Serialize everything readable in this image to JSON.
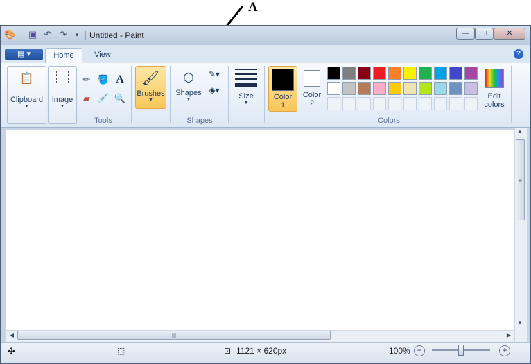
{
  "annotation": {
    "label": "A"
  },
  "window": {
    "title": "Untitled - Paint",
    "quick_access": [
      "paint-app-icon",
      "save-icon",
      "undo-icon",
      "redo-icon",
      "customize-arrow-icon"
    ],
    "controls": {
      "minimize": "—",
      "maximize": "□",
      "close": "✕"
    }
  },
  "ribbon": {
    "app_button": "▤ ▾",
    "tabs": [
      {
        "label": "Home",
        "active": true
      },
      {
        "label": "View",
        "active": false
      }
    ],
    "help": "?",
    "clipboard": {
      "label": "Clipboard"
    },
    "image": {
      "label": "Image"
    },
    "tools": {
      "group_label": "Tools",
      "text_tool": "A"
    },
    "brushes": {
      "label": "Brushes"
    },
    "shapes": {
      "label": "Shapes",
      "group_label": "Shapes"
    },
    "size": {
      "label": "Size"
    },
    "color1": {
      "label_line1": "Color",
      "label_line2": "1",
      "value": "#000000"
    },
    "color2": {
      "label_line1": "Color",
      "label_line2": "2",
      "value": "#ffffff"
    },
    "colors_group_label": "Colors",
    "edit_colors": {
      "line1": "Edit",
      "line2": "colors"
    },
    "palette_row1": [
      "#000000",
      "#7f7f7f",
      "#880015",
      "#ed1c24",
      "#ff7f27",
      "#fff200",
      "#22b14c",
      "#00a2e8",
      "#3f48cc",
      "#a349a4"
    ],
    "palette_row2": [
      "#ffffff",
      "#c3c3c3",
      "#b97a57",
      "#ffaec9",
      "#ffc90e",
      "#efe4b0",
      "#b5e61d",
      "#99d9ea",
      "#7092be",
      "#c8bfe7"
    ]
  },
  "status": {
    "dimensions": "1121 × 620px",
    "zoom": "100%",
    "zoom_level": 1.0
  }
}
